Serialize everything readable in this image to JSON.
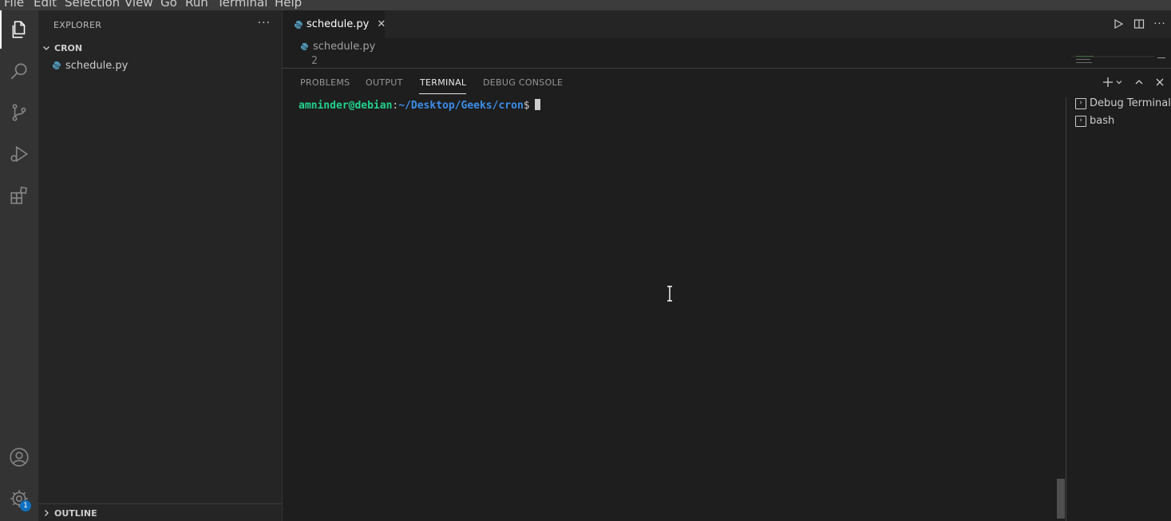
{
  "menu": [
    "File",
    "Edit",
    "Selection",
    "View",
    "Go",
    "Run",
    "Terminal",
    "Help"
  ],
  "activity": {
    "items": [
      "explorer-icon",
      "search-icon",
      "source-control-icon",
      "run-debug-icon",
      "extensions-icon"
    ],
    "bottom": [
      "account-icon",
      "gear-icon"
    ],
    "settings_badge": "1"
  },
  "sidebar": {
    "title": "EXPLORER",
    "more": "···",
    "folder": "CRON",
    "files": [
      "schedule.py"
    ],
    "outline": "OUTLINE"
  },
  "editor": {
    "tab_label": "schedule.py",
    "breadcrumb": "schedule.py",
    "line_number": "2"
  },
  "panel": {
    "tabs": [
      "PROBLEMS",
      "OUTPUT",
      "TERMINAL",
      "DEBUG CONSOLE"
    ],
    "active_tab": "TERMINAL",
    "prompt_user": "amninder@debian",
    "prompt_sep": ":",
    "prompt_path": "~/Desktop/Geeks/cron",
    "prompt_symbol": "$",
    "terminals": [
      "Debug Terminal",
      "bash"
    ]
  },
  "colors": {
    "accent": "#0e70c0",
    "prompt_user": "#23d18b",
    "prompt_path": "#3b8eea",
    "python": "#519aba"
  }
}
